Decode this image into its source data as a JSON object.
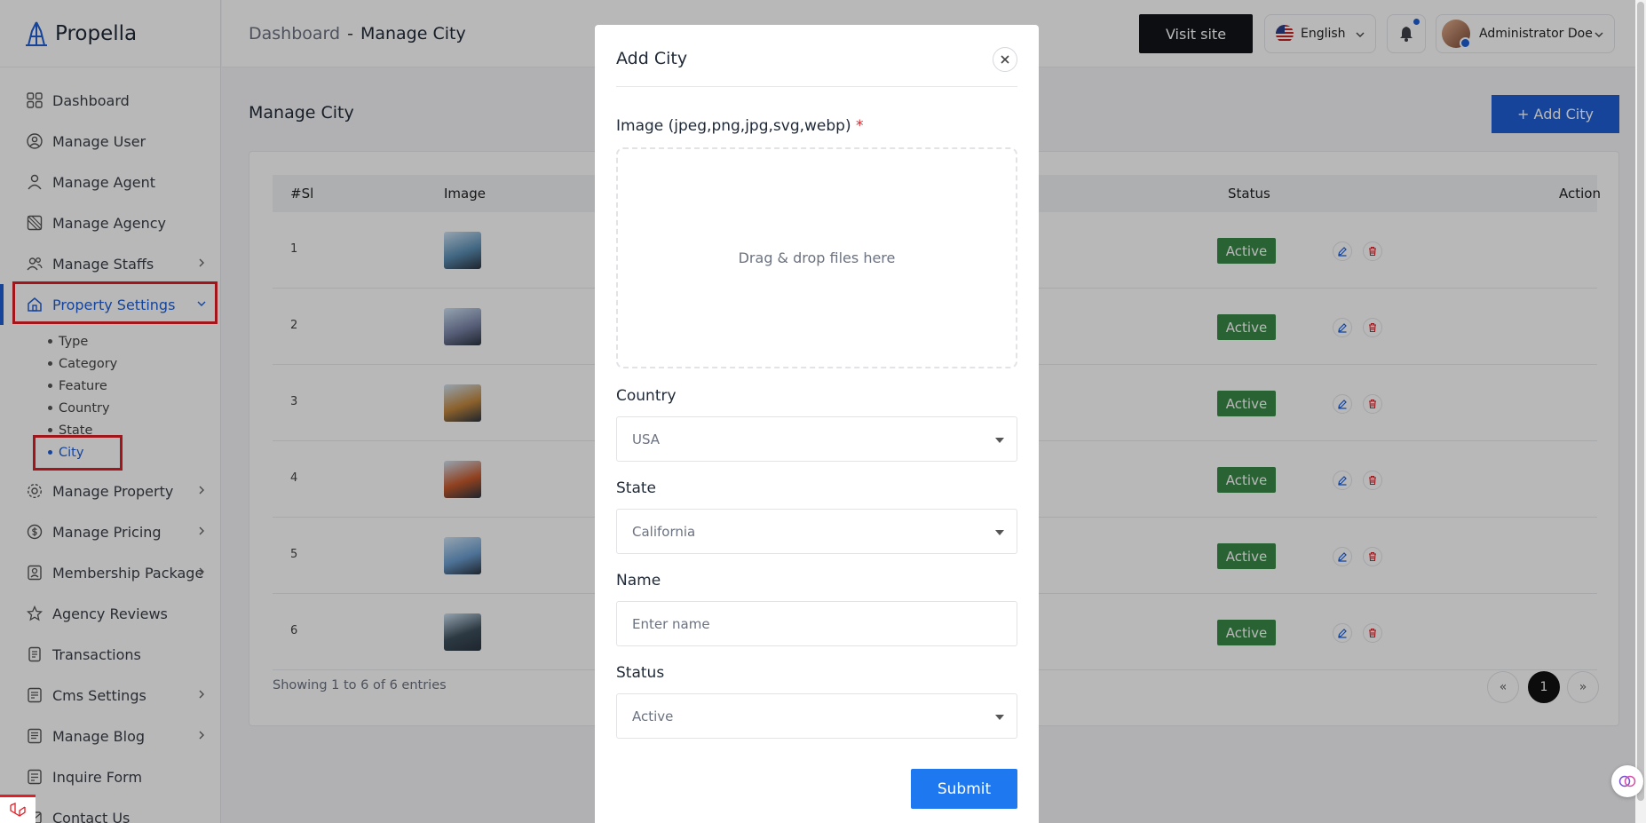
{
  "brand": {
    "name": "Propella"
  },
  "sidebar": {
    "items": [
      {
        "label": "Dashboard",
        "icon": "grid-icon"
      },
      {
        "label": "Manage User",
        "icon": "user-circle-icon"
      },
      {
        "label": "Manage Agent",
        "icon": "agent-icon"
      },
      {
        "label": "Manage Agency",
        "icon": "agency-icon"
      },
      {
        "label": "Manage Staffs",
        "icon": "users-icon",
        "has_children": true
      },
      {
        "label": "Property Settings",
        "icon": "home-icon",
        "has_children": true,
        "active": true
      }
    ],
    "sub_items": [
      {
        "label": "Type"
      },
      {
        "label": "Category"
      },
      {
        "label": "Feature"
      },
      {
        "label": "Country"
      },
      {
        "label": "State"
      },
      {
        "label": "City",
        "active": true
      }
    ],
    "items_after": [
      {
        "label": "Manage Property",
        "icon": "settings-icon",
        "has_children": true
      },
      {
        "label": "Manage Pricing",
        "icon": "dollar-icon",
        "has_children": true
      },
      {
        "label": "Membership Package",
        "icon": "badge-icon",
        "has_children": true
      },
      {
        "label": "Agency Reviews",
        "icon": "star-icon"
      },
      {
        "label": "Transactions",
        "icon": "receipt-icon"
      },
      {
        "label": "Cms Settings",
        "icon": "cms-icon",
        "has_children": true
      },
      {
        "label": "Manage Blog",
        "icon": "blog-icon",
        "has_children": true
      },
      {
        "label": "Inquire Form",
        "icon": "form-icon"
      },
      {
        "label": "Contact Us",
        "icon": "contact-icon"
      }
    ]
  },
  "header": {
    "breadcrumb_root": "Dashboard",
    "breadcrumb_sep": "-",
    "breadcrumb_current": "Manage City",
    "visit_site": "Visit site",
    "language": "English",
    "user_name": "Administrator Doe"
  },
  "main": {
    "title": "Manage City",
    "add_button": "+ Add City",
    "columns": {
      "sl": "#Sl",
      "image": "Image",
      "status": "Status",
      "action": "Action"
    },
    "rows": [
      {
        "sl": "1",
        "status": "Active",
        "thumb_color": "#5b8fb5"
      },
      {
        "sl": "2",
        "status": "Active",
        "thumb_color": "#7a84a8"
      },
      {
        "sl": "3",
        "status": "Active",
        "thumb_color": "#c2873d"
      },
      {
        "sl": "4",
        "status": "Active",
        "thumb_color": "#c85a2c"
      },
      {
        "sl": "5",
        "status": "Active",
        "thumb_color": "#6b9ed0"
      },
      {
        "sl": "6",
        "status": "Active",
        "thumb_color": "#3d4f5c"
      }
    ],
    "showing": "Showing 1 to 6 of 6 entries",
    "pagination": {
      "prev": "«",
      "current": "1",
      "next": "»"
    }
  },
  "modal": {
    "title": "Add City",
    "image_label": "Image (jpeg,png,jpg,svg,webp)",
    "required_mark": "*",
    "dropzone_text": "Drag & drop files here",
    "country_label": "Country",
    "country_value": "USA",
    "state_label": "State",
    "state_value": "California",
    "name_label": "Name",
    "name_placeholder": "Enter name",
    "status_label": "Status",
    "status_value": "Active",
    "submit": "Submit"
  },
  "colors": {
    "accent": "#1e5fd6",
    "active_badge": "#3a8a48",
    "highlight_box": "#e01f26",
    "submit": "#1e78f0"
  }
}
